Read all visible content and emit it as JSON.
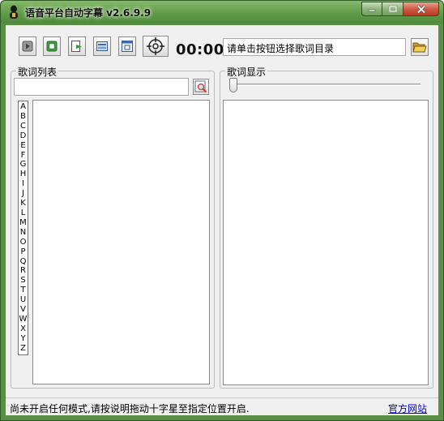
{
  "window": {
    "title": "语音平台自动字幕 v2.6.9.9",
    "icons": [
      "app-icon",
      "minimize-icon",
      "maximize-icon",
      "close-icon"
    ]
  },
  "toolbar": {
    "buttons": [
      {
        "name": "play-button",
        "icon": "play-icon"
      },
      {
        "name": "stop-button",
        "icon": "stop-icon"
      },
      {
        "name": "export-button",
        "icon": "export-icon"
      },
      {
        "name": "lyrics-edit-button",
        "icon": "document-icon"
      },
      {
        "name": "mode-button",
        "icon": "window-icon"
      },
      {
        "name": "crosshair-button",
        "icon": "crosshair-icon"
      }
    ],
    "timer": "00:00",
    "directory_prompt": "请单击按钮选择歌词目录",
    "folder_icon": "folder-open-icon"
  },
  "song_list": {
    "title": "歌词列表",
    "search_value": "",
    "search_icon": "search-icon",
    "letters": [
      "A",
      "B",
      "C",
      "D",
      "E",
      "F",
      "G",
      "H",
      "I",
      "J",
      "K",
      "L",
      "M",
      "N",
      "O",
      "P",
      "Q",
      "R",
      "S",
      "T",
      "U",
      "V",
      "W",
      "X",
      "Y",
      "Z"
    ],
    "items": []
  },
  "lyric_display": {
    "title": "歌词显示",
    "slider_position": 0,
    "content": ""
  },
  "statusbar": {
    "message": "尚未开启任何模式,请按说明拖动十字星至指定位置开启.",
    "official_link": "官方网站"
  },
  "colors": {
    "titlebar": "#5f9b48",
    "link": "#0000d8",
    "panel": "#f0f0f0"
  }
}
